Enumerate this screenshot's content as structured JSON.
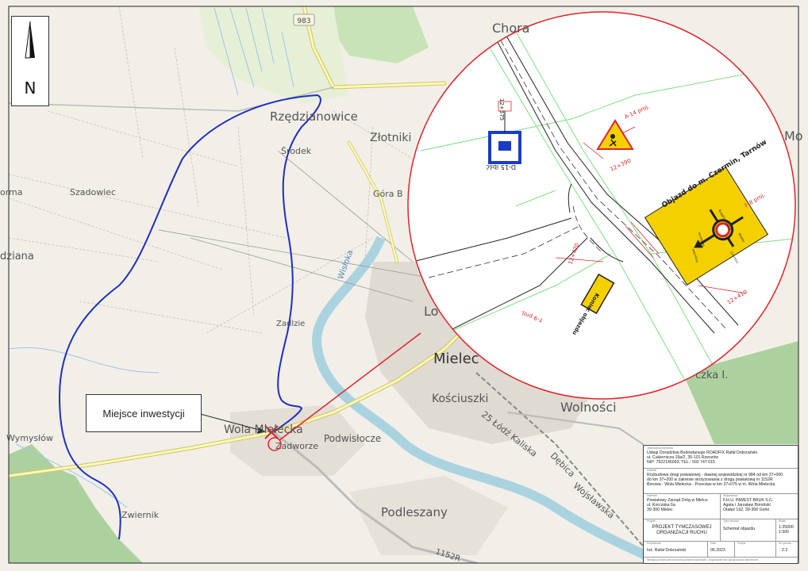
{
  "map": {
    "place_labels": [
      {
        "id": "rzedzianowice",
        "text": "Rzędzianowice"
      },
      {
        "id": "zlotniki",
        "text": "Złotniki"
      },
      {
        "id": "srodek",
        "text": "Środek"
      },
      {
        "id": "szadowiec",
        "text": "Szadowiec"
      },
      {
        "id": "gora",
        "text": "Góra B"
      },
      {
        "id": "orma",
        "text": "orma"
      },
      {
        "id": "dziana",
        "text": "dziana"
      },
      {
        "id": "zadlzie",
        "text": "Zadlzie"
      },
      {
        "id": "mielec",
        "text": "Mielec"
      },
      {
        "id": "kosciuszki",
        "text": "Kościuszki"
      },
      {
        "id": "wolnosci",
        "text": "Wolności"
      },
      {
        "id": "wola_mielecka",
        "text": "Wola Mielecka"
      },
      {
        "id": "zadworze",
        "text": "Zadworze"
      },
      {
        "id": "podwislocze",
        "text": "Podwisłocze"
      },
      {
        "id": "wymyslow",
        "text": "Wymysłów"
      },
      {
        "id": "zwiernik",
        "text": "Zwiernik"
      },
      {
        "id": "podleszany",
        "text": "Podleszany"
      },
      {
        "id": "lodz",
        "text": "25 Łódź Kaliska"
      },
      {
        "id": "debica",
        "text": "Dębica"
      },
      {
        "id": "wojslawska",
        "text": "Wojsławska"
      },
      {
        "id": "lo",
        "text": "Lo"
      },
      {
        "id": "chora",
        "text": "Chora"
      },
      {
        "id": "mo",
        "text": "Mo"
      },
      {
        "id": "czka",
        "text": "czka I."
      },
      {
        "id": "wisloka",
        "text": "Wisłoka"
      }
    ],
    "road_badges": {
      "r983": "983",
      "r1152": "1152R"
    },
    "north_label": "N",
    "callout_text": "Miejsce inwestycji",
    "route_color": "#1f2fbf",
    "marker_color": "#e0242b"
  },
  "detail": {
    "signs": {
      "d15_label": "D-15 ibść",
      "d15_chainage": "12+375",
      "a14_label": "A-14 proj.",
      "a14_chainage": "12+390",
      "f8_label": "F-8 proj.",
      "f8_text": "Objazd do m. Czermin, Tarnów",
      "f8_chainage": "12+410",
      "f9_label": "F-9 proj.",
      "f9_text": "Koniec objazdu",
      "f9_chainage": "12+420",
      "arrow_labels": [
        "Przecław",
        "Podborze",
        "Mielec",
        "Rzędzianowice",
        "Czermin"
      ]
    }
  },
  "title_block": {
    "contractor_caption": "Jednostka projektowa",
    "contractor": [
      "Usługi Doradztwa Budowlanego ROADFIX Rafał Dobrzański",
      "ul. Cukiernicza 19a/2, 35-101 Rzeszów",
      "NIP: 7922145093, TEL.: 502 747 015"
    ],
    "project_caption": "Zadanie",
    "project": [
      "Rozbudowa drogi powiatowej - dawnej wojewódzkiej nr 984 od km 37+000",
      "do km 37+200 w zakresie skrzyżowania z drogą powiatową nr 1152R",
      "Borowa - Wola Mielecka - Przecław w km 37+075 w m. Wola Mielecka"
    ],
    "investor_caption": "Inwestor",
    "investor": [
      "Powiatowy Zarząd Dróg w Mielcu",
      "ul. Korczaka 6a",
      "39-300 Mielec"
    ],
    "executor_caption": "Wykonawca",
    "executor": [
      "F.H.U. INWEST BRUK S.C.",
      "Agata i Jarosław Boroński",
      "Otałęż 192, 39-306 Górki"
    ],
    "phase_caption": "Projekt",
    "phase": [
      "PROJEKT TYMCZASOWEJ",
      "ORGANIZACJI RUCHU"
    ],
    "drawing_caption": "Tytuł rysunku",
    "drawing": "Schemat objazdu",
    "scale_caption": "Skala",
    "scale": [
      "1:25000",
      "1:500"
    ],
    "author_caption": "Projektował",
    "author": "Inż. Rafał Dobrzański",
    "date_caption": "Data",
    "date": "06.2023",
    "sign_caption": "Podpis",
    "sheet_caption": "Nr rysunku",
    "sheet": "2.2",
    "footer": "Niniejszy projekt jest chroniony prawem autorskim - kopiowanie bez zgody autora zabronione"
  }
}
